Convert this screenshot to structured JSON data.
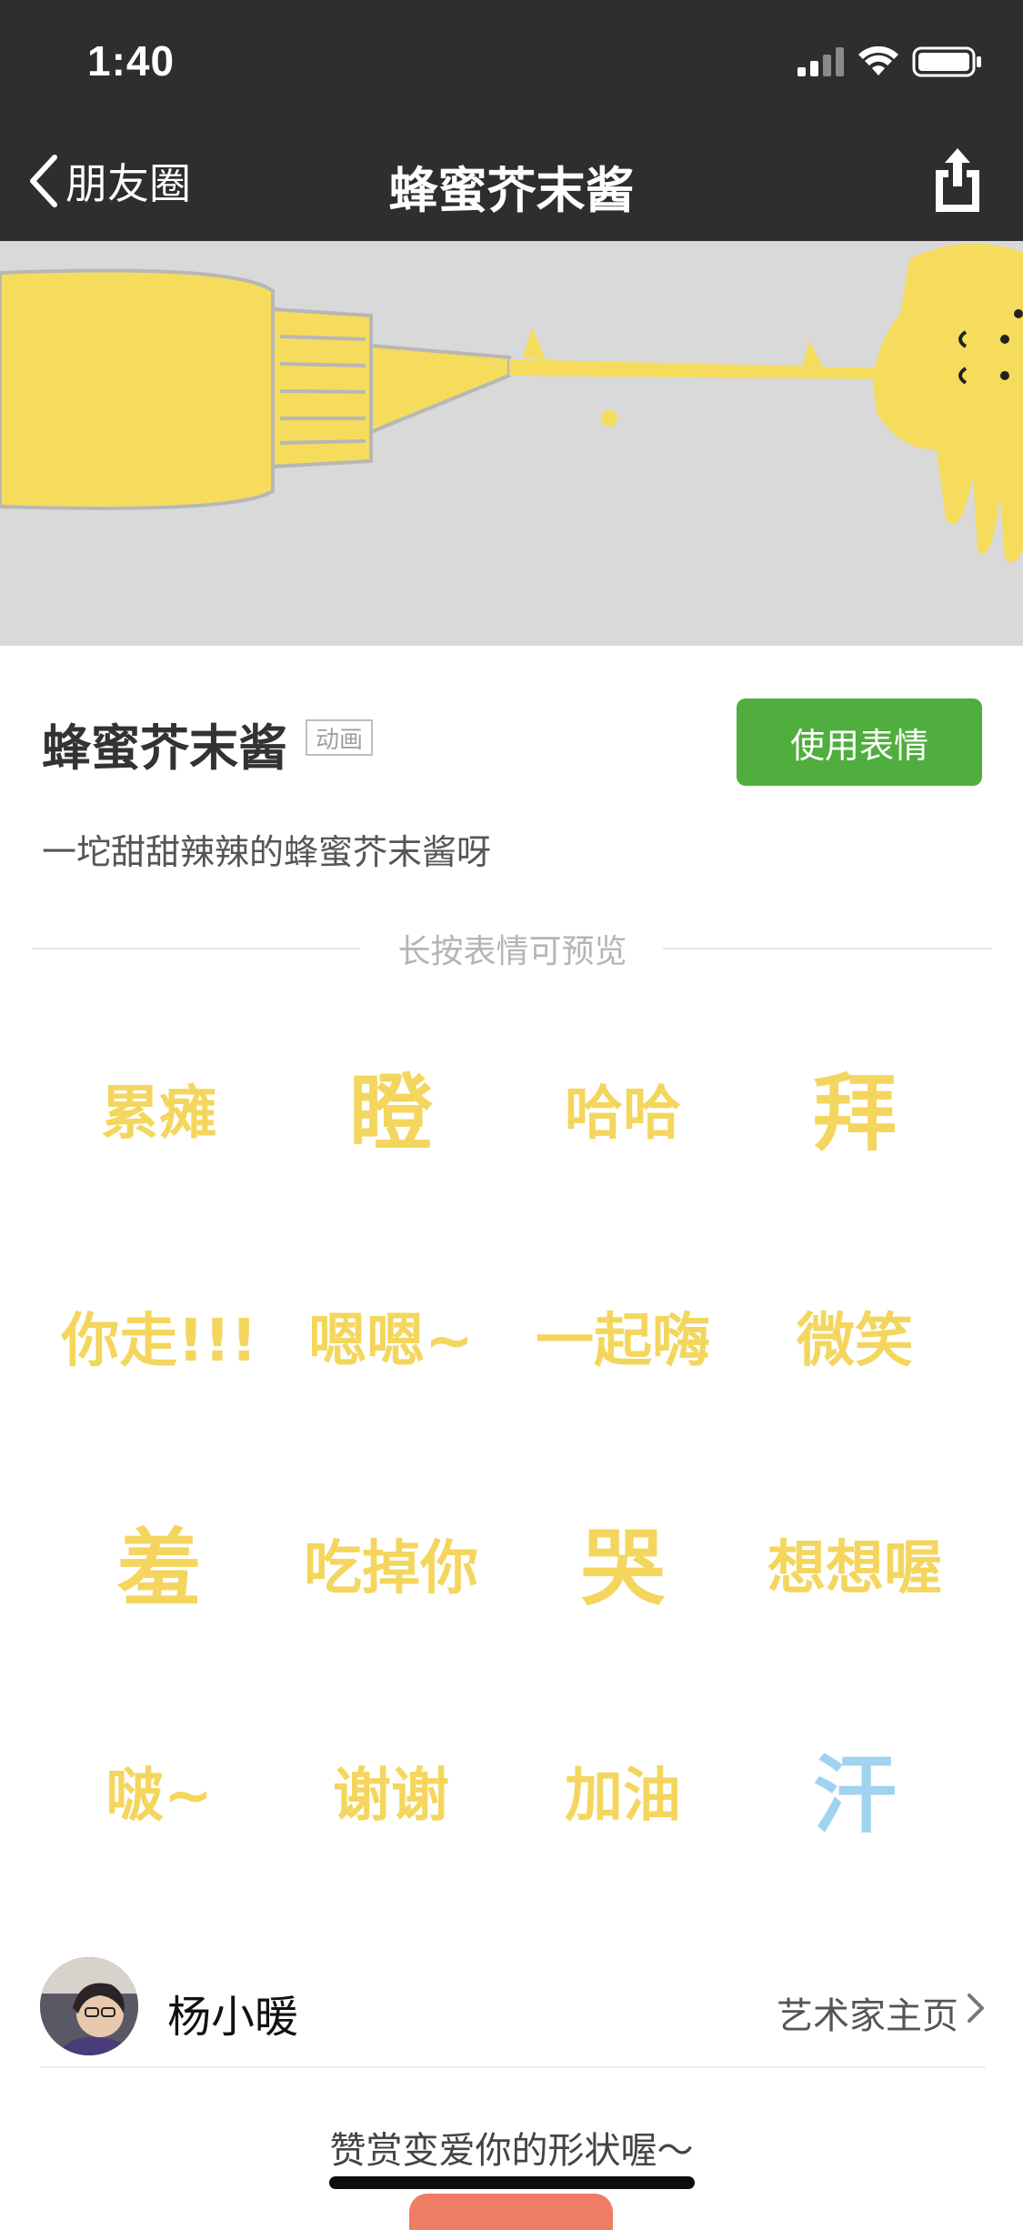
{
  "status_bar": {
    "time": "1:40"
  },
  "nav": {
    "back_label": "朋友圈",
    "title": "蜂蜜芥末酱",
    "share_icon": "share-icon"
  },
  "pack": {
    "title": "蜂蜜芥末酱",
    "tag": "动画",
    "use_button": "使用表情",
    "description": "一坨甜甜辣辣的蜂蜜芥末酱呀",
    "hint": "长按表情可预览"
  },
  "stickers": [
    {
      "text": "累瘫"
    },
    {
      "text": "瞪"
    },
    {
      "text": "哈哈"
    },
    {
      "text": "拜"
    },
    {
      "text": "你走!!!"
    },
    {
      "text": "嗯嗯~"
    },
    {
      "text": "一起嗨"
    },
    {
      "text": "微笑"
    },
    {
      "text": "羞"
    },
    {
      "text": "吃掉你"
    },
    {
      "text": "哭"
    },
    {
      "text": "想想喔"
    },
    {
      "text": "啵~"
    },
    {
      "text": "谢谢"
    },
    {
      "text": "加油"
    },
    {
      "text": "汗"
    }
  ],
  "artist": {
    "name": "杨小暖",
    "link_label": "艺术家主页"
  },
  "reward": {
    "text": "赞赏变爱你的形状喔～"
  },
  "colors": {
    "nav_background": "#2e2e30",
    "accent_green": "#4fae3d",
    "sticker_yellow": "#f4d65e",
    "reward_button": "#ef7c64"
  }
}
